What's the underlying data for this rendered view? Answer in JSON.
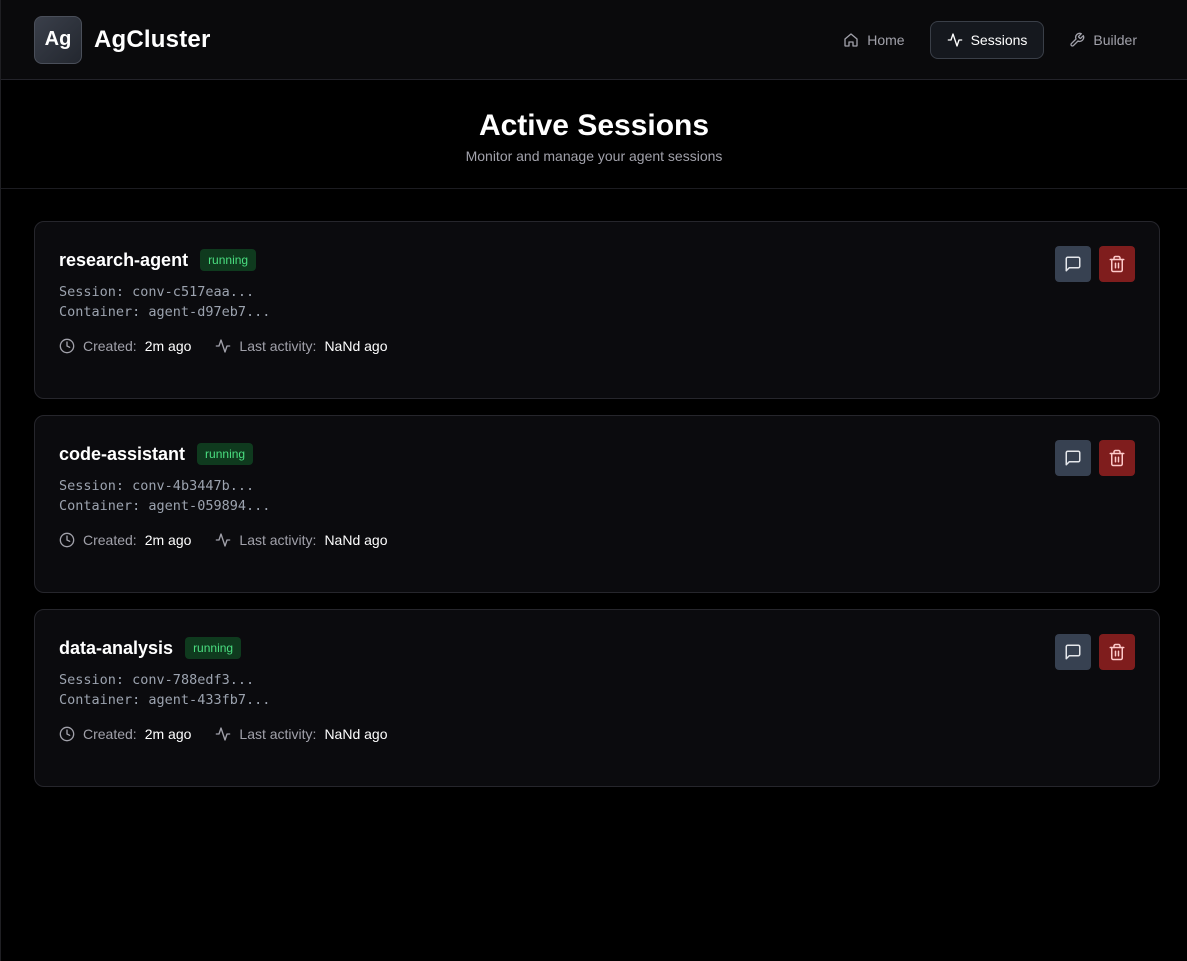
{
  "app": {
    "logo_text": "Ag",
    "name": "AgCluster"
  },
  "nav": {
    "home": "Home",
    "sessions": "Sessions",
    "builder": "Builder",
    "active": "sessions"
  },
  "hero": {
    "title": "Active Sessions",
    "subtitle": "Monitor and manage your agent sessions"
  },
  "labels": {
    "session_prefix": "Session:",
    "container_prefix": "Container:",
    "created": "Created:",
    "last_activity": "Last activity:"
  },
  "sessions": [
    {
      "name": "research-agent",
      "status": "running",
      "session_id": "conv-c517eaa...",
      "container_id": "agent-d97eb7...",
      "created": "2m ago",
      "last_activity": "NaNd ago"
    },
    {
      "name": "code-assistant",
      "status": "running",
      "session_id": "conv-4b3447b...",
      "container_id": "agent-059894...",
      "created": "2m ago",
      "last_activity": "NaNd ago"
    },
    {
      "name": "data-analysis",
      "status": "running",
      "session_id": "conv-788edf3...",
      "container_id": "agent-433fb7...",
      "created": "2m ago",
      "last_activity": "NaNd ago"
    }
  ],
  "colors": {
    "status_running_bg": "#0f3a1e",
    "status_running_text": "#4ade80",
    "delete_button": "#7f1d1d",
    "chat_button": "#374151"
  },
  "icons": {
    "home": "home-icon",
    "sessions": "activity-icon",
    "builder": "wrench-icon",
    "created": "clock-icon",
    "last_activity": "activity-icon",
    "chat": "message-square-icon",
    "delete": "trash-icon"
  }
}
